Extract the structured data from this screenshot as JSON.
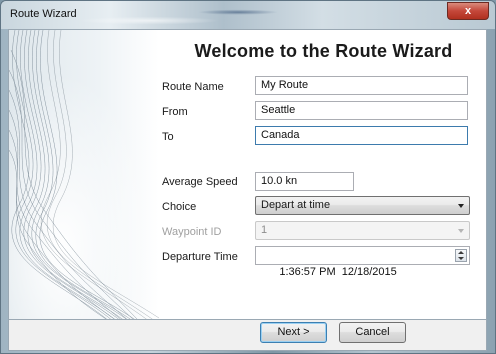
{
  "window": {
    "title": "Route Wizard",
    "close_glyph": "x"
  },
  "heading": "Welcome to the Route Wizard",
  "form": {
    "route_name": {
      "label": "Route Name",
      "value": "My Route"
    },
    "from": {
      "label": "From",
      "value": "Seattle"
    },
    "to": {
      "label": "To",
      "value": "Canada"
    },
    "average_speed": {
      "label": "Average Speed",
      "value": "10.0 kn"
    },
    "choice": {
      "label": "Choice",
      "value": "Depart at time"
    },
    "waypoint_id": {
      "label": "Waypoint ID",
      "value": "1",
      "enabled": false
    },
    "departure_time": {
      "label": "Departure Time",
      "value": "1:36:57 PM  12/18/2015"
    }
  },
  "buttons": {
    "next": "Next >",
    "cancel": "Cancel"
  },
  "icons": [
    "close-icon",
    "chevron-down-icon",
    "spin-up-icon",
    "spin-down-icon"
  ],
  "colors": {
    "focus_border": "#3d7bad",
    "close_button": "#c4473a"
  }
}
